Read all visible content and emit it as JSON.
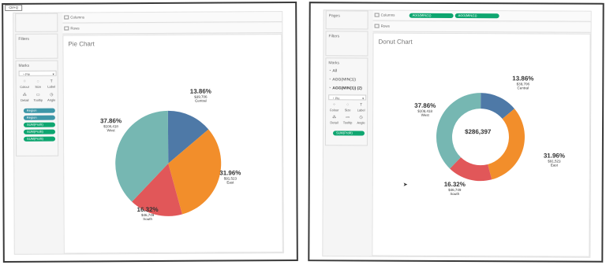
{
  "left": {
    "ctrl_badge": "Ctrl+Q",
    "shelves": {
      "columns": "Columns",
      "rows": "Rows"
    },
    "filters": "Filters",
    "marks": {
      "title": "Marks",
      "type": "Pie",
      "buttons": [
        "Colour",
        "Size",
        "Label",
        "Detail",
        "Tooltip",
        "Angle"
      ],
      "pills": [
        "Region",
        "Region",
        "SUM(Profit)",
        "SUM(Profit)",
        "SUM(Profit)"
      ]
    },
    "title": "Pie Chart",
    "labels": [
      {
        "pct": "13.86%",
        "amt": "$39,706",
        "region": "Central"
      },
      {
        "pct": "31.96%",
        "amt": "$91,523",
        "region": "East"
      },
      {
        "pct": "16.32%",
        "amt": "$46,749",
        "region": "South"
      },
      {
        "pct": "37.86%",
        "amt": "$108,418",
        "region": "West"
      }
    ]
  },
  "right": {
    "shelves": {
      "pages": "Pages",
      "columns": "Columns",
      "rows": "Rows"
    },
    "column_pills": [
      "AGG(MIN(1))",
      "AGG(MIN(1))"
    ],
    "filters": "Filters",
    "marks": {
      "title": "Marks",
      "rows": [
        "All",
        "AGG(MIN(1))",
        "AGG(MIN(1)) (2)"
      ],
      "type": "Pie",
      "buttons": [
        "Colour",
        "Size",
        "Label",
        "Detail",
        "Tooltip",
        "Angle"
      ],
      "pill": "SUM(Profit)"
    },
    "title": "Donut Chart",
    "center": "$286,397",
    "labels": [
      {
        "pct": "13.86%",
        "amt": "$39,706",
        "region": "Central"
      },
      {
        "pct": "31.96%",
        "amt": "$91,523",
        "region": "East"
      },
      {
        "pct": "16.32%",
        "amt": "$46,749",
        "region": "South"
      },
      {
        "pct": "37.86%",
        "amt": "$108,418",
        "region": "West"
      }
    ]
  },
  "colors": {
    "central": "#4e79a7",
    "east": "#f28e2b",
    "south": "#e15759",
    "west": "#76b7b2",
    "pill_teal": "#3e97a8",
    "pill_green": "#0ea670"
  },
  "chart_data": [
    {
      "type": "pie",
      "title": "Pie Chart",
      "categories": [
        "Central",
        "East",
        "South",
        "West"
      ],
      "values": [
        39706,
        91523,
        46749,
        108418
      ],
      "percent": [
        13.86,
        31.96,
        16.32,
        37.86
      ]
    },
    {
      "type": "pie",
      "title": "Donut Chart",
      "categories": [
        "Central",
        "East",
        "South",
        "West"
      ],
      "values": [
        39706,
        91523,
        46749,
        108418
      ],
      "percent": [
        13.86,
        31.96,
        16.32,
        37.86
      ],
      "total": "$286,397"
    }
  ]
}
